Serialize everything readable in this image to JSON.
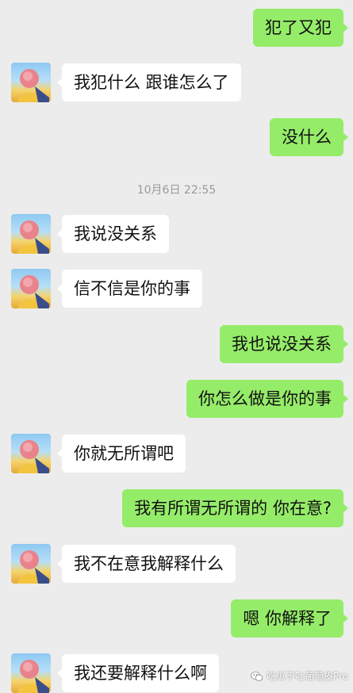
{
  "chat": {
    "timestamp": "10月6日 22:55",
    "messages": [
      {
        "side": "out",
        "text": "犯了又犯"
      },
      {
        "side": "in",
        "text": "我犯什么 跟谁怎么了"
      },
      {
        "side": "out",
        "text": "没什么"
      },
      {
        "side": "in",
        "text": "我说没关系"
      },
      {
        "side": "in",
        "text": "信不信是你的事"
      },
      {
        "side": "out",
        "text": "我也说没关系"
      },
      {
        "side": "out",
        "text": "你怎么做是你的事"
      },
      {
        "side": "in",
        "text": "你就无所谓吧"
      },
      {
        "side": "out",
        "text": "我有所谓无所谓的 你在意?"
      },
      {
        "side": "in",
        "text": "我不在意我解释什么"
      },
      {
        "side": "out",
        "text": "嗯 你解释了"
      },
      {
        "side": "in",
        "text": "我还要解释什么啊"
      }
    ]
  },
  "watermark": {
    "text": "吃瓜不吐葡萄皮Pro",
    "icon": "wechat-icon"
  },
  "colors": {
    "background": "#ececec",
    "outgoing_bubble": "#95ec69",
    "incoming_bubble": "#ffffff",
    "timestamp_text": "#9a9a9a"
  }
}
